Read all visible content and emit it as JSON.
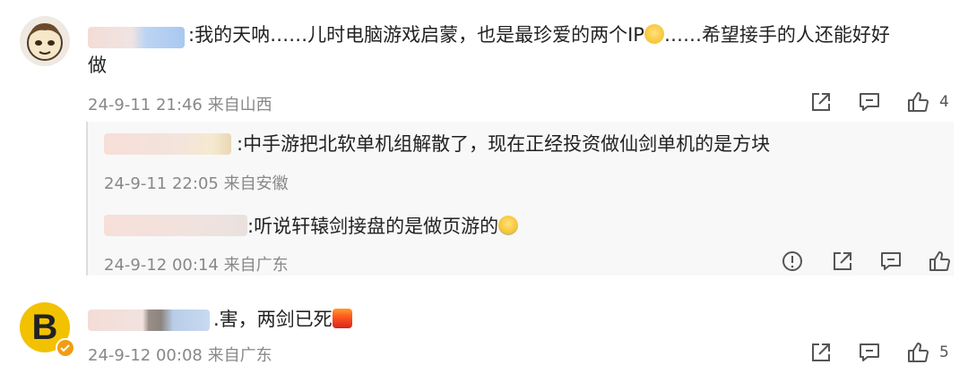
{
  "comments": [
    {
      "text_prefix": ":我的天呐……儿时电脑游戏启蒙，也是最珍爱的两个IP",
      "text_suffix": "……希望接手的人还能好好",
      "text_line2": "做",
      "meta": "24-9-11 21:46 来自山西",
      "like_count": "4"
    },
    {
      "text": ".害，两剑已死",
      "meta": "24-9-12 00:08 来自广东",
      "like_count": "5"
    }
  ],
  "replies": [
    {
      "text": ":中手游把北软单机组解散了，现在正经投资做仙剑单机的是方块",
      "meta": "24-9-11 22:05 来自安徽"
    },
    {
      "text": ":听说轩辕剑接盘的是做页游的",
      "meta": "24-9-12 00:14 来自广东"
    }
  ],
  "avatar2_letter": "B",
  "colors": {
    "meta_gray": "#888888",
    "icon_gray": "#555555",
    "avatar_yellow": "#f2c200"
  }
}
